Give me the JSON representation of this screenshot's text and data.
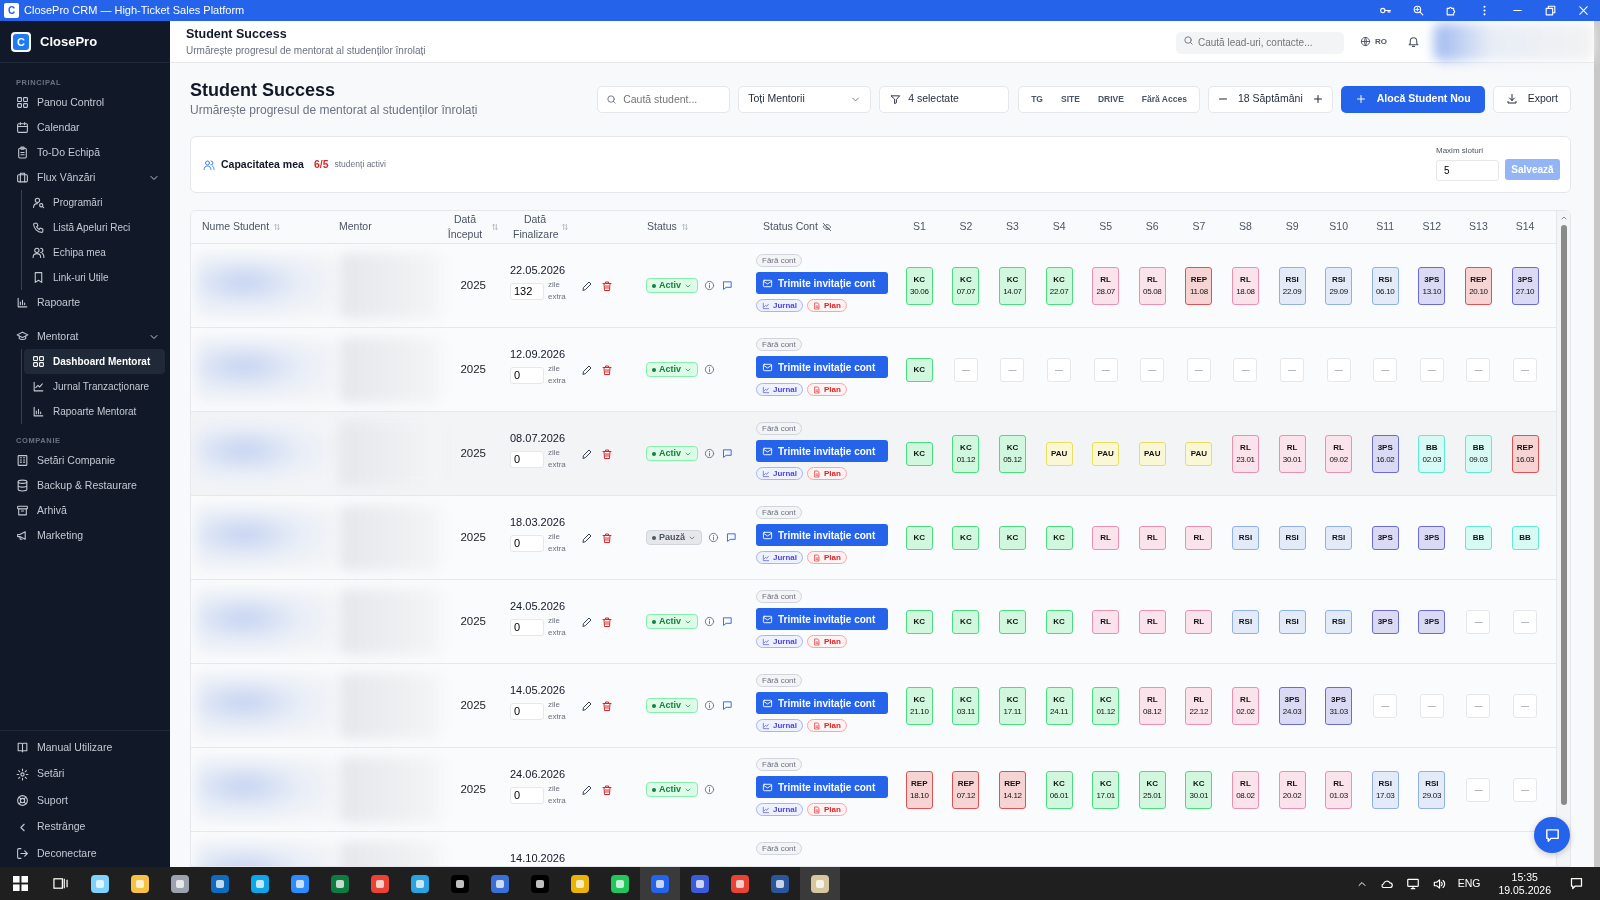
{
  "title_bar": {
    "logo": "C",
    "title": "ClosePro CRM — High-Ticket Sales Platform"
  },
  "sidebar": {
    "logo": "C",
    "brand": "ClosePro",
    "sections": [
      {
        "label": "PRINCIPAL",
        "items": [
          {
            "label": "Panou Control",
            "selected": false
          },
          {
            "label": "Calendar",
            "selected": false
          },
          {
            "label": "To-Do Echipă",
            "selected": false
          },
          {
            "label": "Flux Vânzări",
            "selected": false,
            "expanded": true,
            "children": [
              {
                "label": "Programări",
                "selected": false
              },
              {
                "label": "Listă Apeluri Reci",
                "selected": false
              },
              {
                "label": "Echipa mea",
                "selected": false
              },
              {
                "label": "Link-uri Utile",
                "selected": false
              }
            ]
          },
          {
            "label": "Rapoarte",
            "selected": false
          }
        ]
      },
      {
        "items": [
          {
            "label": "Mentorat",
            "selected": false,
            "expanded": true,
            "children": [
              {
                "label": "Dashboard Mentorat",
                "selected": true
              },
              {
                "label": "Jurnal Tranzacționare",
                "selected": false
              },
              {
                "label": "Rapoarte Mentorat",
                "selected": false
              }
            ]
          }
        ]
      },
      {
        "label": "COMPANIE",
        "items": [
          {
            "label": "Setări Companie",
            "selected": false
          },
          {
            "label": "Backup & Restaurare",
            "selected": false
          },
          {
            "label": "Arhivă",
            "selected": false
          },
          {
            "label": "Marketing",
            "selected": false
          }
        ]
      }
    ],
    "footer_items": [
      {
        "label": "Manual Utilizare"
      },
      {
        "label": "Setări"
      },
      {
        "label": "Suport"
      },
      {
        "label": "Restrânge"
      },
      {
        "label": "Deconectare"
      }
    ]
  },
  "header": {
    "title": "Student Success",
    "subtitle": "Urmărește progresul de mentorat al studenților înrolați",
    "search": {
      "placeholder": "Caută lead-uri, contacte..."
    },
    "language": "RO"
  },
  "page": {
    "title": "Student Success",
    "subtitle": "Urmărește progresul de mentorat al studenților înrolați",
    "search": {
      "placeholder": "Caută student..."
    },
    "mentor_filter": "Toți Mentorii",
    "status_filter": "4 selectate",
    "access_filters": [
      {
        "label": "TG",
        "selected": false
      },
      {
        "label": "SITE",
        "selected": false
      },
      {
        "label": "DRIVE",
        "selected": false
      },
      {
        "label": "Fără Acces",
        "selected": false
      }
    ],
    "weeks": "18 Săptămâni",
    "add_button": "Alocă Student Nou",
    "export_button": "Export"
  },
  "capacity": {
    "label": "Capacitatea mea",
    "count": "6/5",
    "over_limit": true,
    "suffix": "studenți activi",
    "max_label": "Maxim sloturi",
    "max_value": "5",
    "save": {
      "label": "Salvează",
      "disabled": true
    }
  },
  "table": {
    "columns": [
      {
        "label": "Nume Student",
        "kind": "sort"
      },
      {
        "label": "Mentor",
        "kind": "plain"
      },
      {
        "label": "Dată Început",
        "kind": "sort"
      },
      {
        "label": "Dată Finalizare",
        "kind": "sort"
      },
      {
        "label": "Status",
        "kind": "sort"
      },
      {
        "label": "Status Cont",
        "kind": "visibility"
      }
    ],
    "week_columns": [
      "S1",
      "S2",
      "S3",
      "S4",
      "S5",
      "S6",
      "S7",
      "S8",
      "S9",
      "S10",
      "S11",
      "S12",
      "S13",
      "S14"
    ],
    "rows": [
      {
        "hovered": false,
        "start_date": "2025",
        "end_date": "22.05.2026",
        "extra_days": "132",
        "extra_label": "zile extra",
        "status": {
          "label": "Activ",
          "kind": "active"
        },
        "has_comment": true,
        "account": "Fără cont",
        "invite": "Trimite invitație cont",
        "tags": [
          "Jurnal",
          "Plan"
        ],
        "weeks": [
          {
            "kind": "week",
            "code": "KC",
            "date": "30.06",
            "color": "#4ade80"
          },
          {
            "kind": "week",
            "code": "KC",
            "date": "07.07",
            "color": "#4ade80"
          },
          {
            "kind": "week",
            "code": "KC",
            "date": "14.07",
            "color": "#4ade80"
          },
          {
            "kind": "week",
            "code": "KC",
            "date": "22.07",
            "color": "#4ade80"
          },
          {
            "kind": "week",
            "code": "RL",
            "date": "28.07",
            "color": "#ec8fb0"
          },
          {
            "kind": "week",
            "code": "RL",
            "date": "05.08",
            "color": "#ec8fb0"
          },
          {
            "kind": "week",
            "code": "REP",
            "date": "11.08",
            "color": "#e05252"
          },
          {
            "kind": "week",
            "code": "RL",
            "date": "18.08",
            "color": "#ec8fb0"
          },
          {
            "kind": "week",
            "code": "RSI",
            "date": "22.09",
            "color": "#8fb0e8"
          },
          {
            "kind": "week",
            "code": "RSI",
            "date": "29.09",
            "color": "#8fb0e8"
          },
          {
            "kind": "week",
            "code": "RSI",
            "date": "06.10",
            "color": "#8fb0e8"
          },
          {
            "kind": "week",
            "code": "3PS",
            "date": "13.10",
            "color": "#6b6bd6"
          },
          {
            "kind": "week",
            "code": "REP",
            "date": "20.10",
            "color": "#e05252"
          },
          {
            "kind": "week",
            "code": "3PS",
            "date": "27.10",
            "color": "#6b6bd6"
          }
        ]
      },
      {
        "hovered": false,
        "start_date": "2025",
        "end_date": "12.09.2026",
        "extra_days": "0",
        "extra_label": "zile extra",
        "status": {
          "label": "Activ",
          "kind": "active"
        },
        "has_comment": false,
        "account": "Fără cont",
        "invite": "Trimite invitație cont",
        "tags": [
          "Jurnal",
          "Plan"
        ],
        "weeks": [
          {
            "kind": "week",
            "code": "KC",
            "color": "#4ade80"
          },
          {
            "kind": "empty",
            "text": "—"
          },
          {
            "kind": "empty",
            "text": "—"
          },
          {
            "kind": "empty",
            "text": "—"
          },
          {
            "kind": "empty",
            "text": "—"
          },
          {
            "kind": "empty",
            "text": "—"
          },
          {
            "kind": "empty",
            "text": "—"
          },
          {
            "kind": "empty",
            "text": "—"
          },
          {
            "kind": "empty",
            "text": "—"
          },
          {
            "kind": "empty",
            "text": "—"
          },
          {
            "kind": "empty",
            "text": "—"
          },
          {
            "kind": "empty",
            "text": "—"
          },
          {
            "kind": "empty",
            "text": "—"
          },
          {
            "kind": "empty",
            "text": "—"
          }
        ]
      },
      {
        "hovered": true,
        "start_date": "2025",
        "end_date": "08.07.2026",
        "extra_days": "0",
        "extra_label": "zile extra",
        "status": {
          "label": "Activ",
          "kind": "active"
        },
        "has_comment": true,
        "account": "Fără cont",
        "invite": "Trimite invitație cont",
        "tags": [
          "Jurnal",
          "Plan"
        ],
        "weeks": [
          {
            "kind": "week",
            "code": "KC",
            "color": "#4ade80"
          },
          {
            "kind": "week",
            "code": "KC",
            "date": "01.12",
            "color": "#4ade80"
          },
          {
            "kind": "week",
            "code": "KC",
            "date": "05.12",
            "color": "#4ade80"
          },
          {
            "kind": "week",
            "code": "PAU",
            "color": "#e8e05a"
          },
          {
            "kind": "week",
            "code": "PAU",
            "color": "#e8e05a"
          },
          {
            "kind": "week",
            "code": "PAU",
            "color": "#e8e05a"
          },
          {
            "kind": "week",
            "code": "PAU",
            "color": "#e8e05a"
          },
          {
            "kind": "week",
            "code": "RL",
            "date": "23.01",
            "color": "#ec8fb0"
          },
          {
            "kind": "week",
            "code": "RL",
            "date": "30.01",
            "color": "#ec8fb0"
          },
          {
            "kind": "week",
            "code": "RL",
            "date": "09.02",
            "color": "#ec8fb0"
          },
          {
            "kind": "week",
            "code": "3PS",
            "date": "16.02",
            "color": "#6b6bd6"
          },
          {
            "kind": "week",
            "code": "BB",
            "date": "02.03",
            "color": "#5eead4"
          },
          {
            "kind": "week",
            "code": "BB",
            "date": "09.03",
            "color": "#5eead4"
          },
          {
            "kind": "week",
            "code": "REP",
            "date": "16.03",
            "color": "#e05252"
          }
        ]
      },
      {
        "hovered": false,
        "start_date": "2025",
        "end_date": "18.03.2026",
        "extra_days": "0",
        "extra_label": "zile extra",
        "status": {
          "label": "Pauză",
          "kind": "paused"
        },
        "has_comment": true,
        "account": "Fără cont",
        "invite": "Trimite invitație cont",
        "tags": [
          "Jurnal",
          "Plan"
        ],
        "weeks": [
          {
            "kind": "week",
            "code": "KC",
            "color": "#4ade80"
          },
          {
            "kind": "week",
            "code": "KC",
            "color": "#4ade80"
          },
          {
            "kind": "week",
            "code": "KC",
            "color": "#4ade80"
          },
          {
            "kind": "week",
            "code": "KC",
            "color": "#4ade80"
          },
          {
            "kind": "week",
            "code": "RL",
            "color": "#ec8fb0"
          },
          {
            "kind": "week",
            "code": "RL",
            "color": "#ec8fb0"
          },
          {
            "kind": "week",
            "code": "RL",
            "color": "#ec8fb0"
          },
          {
            "kind": "week",
            "code": "RSI",
            "color": "#8fb0e8"
          },
          {
            "kind": "week",
            "code": "RSI",
            "color": "#8fb0e8"
          },
          {
            "kind": "week",
            "code": "RSI",
            "color": "#8fb0e8"
          },
          {
            "kind": "week",
            "code": "3PS",
            "color": "#6b6bd6"
          },
          {
            "kind": "week",
            "code": "3PS",
            "color": "#6b6bd6"
          },
          {
            "kind": "week",
            "code": "BB",
            "color": "#5eead4"
          },
          {
            "kind": "week",
            "code": "BB",
            "color": "#5eead4"
          }
        ]
      },
      {
        "hovered": false,
        "start_date": "2025",
        "end_date": "24.05.2026",
        "extra_days": "0",
        "extra_label": "zile extra",
        "status": {
          "label": "Activ",
          "kind": "active"
        },
        "has_comment": true,
        "account": "Fără cont",
        "invite": "Trimite invitație cont",
        "tags": [
          "Jurnal",
          "Plan"
        ],
        "weeks": [
          {
            "kind": "week",
            "code": "KC",
            "color": "#4ade80"
          },
          {
            "kind": "week",
            "code": "KC",
            "color": "#4ade80"
          },
          {
            "kind": "week",
            "code": "KC",
            "color": "#4ade80"
          },
          {
            "kind": "week",
            "code": "KC",
            "color": "#4ade80"
          },
          {
            "kind": "week",
            "code": "RL",
            "color": "#ec8fb0"
          },
          {
            "kind": "week",
            "code": "RL",
            "color": "#ec8fb0"
          },
          {
            "kind": "week",
            "code": "RL",
            "color": "#ec8fb0"
          },
          {
            "kind": "week",
            "code": "RSI",
            "color": "#8fb0e8"
          },
          {
            "kind": "week",
            "code": "RSI",
            "color": "#8fb0e8"
          },
          {
            "kind": "week",
            "code": "RSI",
            "color": "#8fb0e8"
          },
          {
            "kind": "week",
            "code": "3PS",
            "color": "#6b6bd6"
          },
          {
            "kind": "week",
            "code": "3PS",
            "color": "#6b6bd6"
          },
          {
            "kind": "empty",
            "text": "—"
          },
          {
            "kind": "empty",
            "text": "—"
          }
        ]
      },
      {
        "hovered": false,
        "start_date": "2025",
        "end_date": "14.05.2026",
        "extra_days": "0",
        "extra_label": "zile extra",
        "status": {
          "label": "Activ",
          "kind": "active"
        },
        "has_comment": true,
        "account": "Fără cont",
        "invite": "Trimite invitație cont",
        "tags": [
          "Jurnal",
          "Plan"
        ],
        "weeks": [
          {
            "kind": "week",
            "code": "KC",
            "date": "21.10",
            "color": "#4ade80"
          },
          {
            "kind": "week",
            "code": "KC",
            "date": "03.11",
            "color": "#4ade80"
          },
          {
            "kind": "week",
            "code": "KC",
            "date": "17.11",
            "color": "#4ade80"
          },
          {
            "kind": "week",
            "code": "KC",
            "date": "24.11",
            "color": "#4ade80"
          },
          {
            "kind": "week",
            "code": "KC",
            "date": "01.12",
            "color": "#4ade80"
          },
          {
            "kind": "week",
            "code": "RL",
            "date": "08.12",
            "color": "#ec8fb0"
          },
          {
            "kind": "week",
            "code": "RL",
            "date": "22.12",
            "color": "#ec8fb0"
          },
          {
            "kind": "week",
            "code": "RL",
            "date": "02.02",
            "color": "#ec8fb0"
          },
          {
            "kind": "week",
            "code": "3PS",
            "date": "24.03",
            "color": "#6b6bd6"
          },
          {
            "kind": "week",
            "code": "3PS",
            "date": "31.03",
            "color": "#6b6bd6"
          },
          {
            "kind": "empty",
            "text": "—"
          },
          {
            "kind": "empty",
            "text": "—"
          },
          {
            "kind": "empty",
            "text": "—"
          },
          {
            "kind": "empty",
            "text": "—"
          }
        ]
      },
      {
        "hovered": false,
        "start_date": "2025",
        "end_date": "24.06.2026",
        "extra_days": "0",
        "extra_label": "zile extra",
        "status": {
          "label": "Activ",
          "kind": "active"
        },
        "has_comment": false,
        "account": "Fără cont",
        "invite": "Trimite invitație cont",
        "tags": [
          "Jurnal",
          "Plan"
        ],
        "weeks": [
          {
            "kind": "week",
            "code": "REP",
            "date": "18.10",
            "color": "#e05252"
          },
          {
            "kind": "week",
            "code": "REP",
            "date": "07.12",
            "color": "#e05252"
          },
          {
            "kind": "week",
            "code": "REP",
            "date": "14.12",
            "color": "#e05252"
          },
          {
            "kind": "week",
            "code": "KC",
            "date": "06.01",
            "color": "#4ade80"
          },
          {
            "kind": "week",
            "code": "KC",
            "date": "17.01",
            "color": "#4ade80"
          },
          {
            "kind": "week",
            "code": "KC",
            "date": "25.01",
            "color": "#4ade80"
          },
          {
            "kind": "week",
            "code": "KC",
            "date": "30.01",
            "color": "#4ade80"
          },
          {
            "kind": "week",
            "code": "RL",
            "date": "08.02",
            "color": "#ec8fb0"
          },
          {
            "kind": "week",
            "code": "RL",
            "date": "20.02",
            "color": "#ec8fb0"
          },
          {
            "kind": "week",
            "code": "RL",
            "date": "01.03",
            "color": "#ec8fb0"
          },
          {
            "kind": "week",
            "code": "RSI",
            "date": "17.03",
            "color": "#8fb0e8"
          },
          {
            "kind": "week",
            "code": "RSI",
            "date": "29.03",
            "color": "#8fb0e8"
          },
          {
            "kind": "empty",
            "text": "—"
          },
          {
            "kind": "empty",
            "text": "—"
          }
        ]
      },
      {
        "end_date": "14.10.2026",
        "account": "Fără cont"
      }
    ]
  },
  "taskbar": {
    "apps": [
      {
        "color": "#7dd3fc",
        "active": false
      },
      {
        "color": "#f6c244",
        "active": false
      },
      {
        "color": "#9ca3af",
        "active": false
      },
      {
        "color": "#0f6cbd",
        "active": false
      },
      {
        "color": "#0ea5e9",
        "active": false
      },
      {
        "color": "#2d8cff",
        "active": false
      },
      {
        "color": "#107c41",
        "active": false
      },
      {
        "color": "#ea4335",
        "active": false
      },
      {
        "color": "#2aa3e0",
        "active": false
      },
      {
        "color": "#000000",
        "active": false
      },
      {
        "color": "#3b6fd8",
        "active": false
      },
      {
        "color": "#000000",
        "active": false
      },
      {
        "color": "#eab308",
        "active": false
      },
      {
        "color": "#22c55e",
        "active": false
      },
      {
        "color": "#2563eb",
        "active": true
      },
      {
        "color": "#3b5bdb",
        "active": false
      },
      {
        "color": "#ea4335",
        "active": false
      },
      {
        "color": "#2b579a",
        "active": false
      },
      {
        "color": "#d6c7a1",
        "active": true
      }
    ],
    "language": "ENG",
    "time": "15:35",
    "date": "19.05.2026"
  }
}
